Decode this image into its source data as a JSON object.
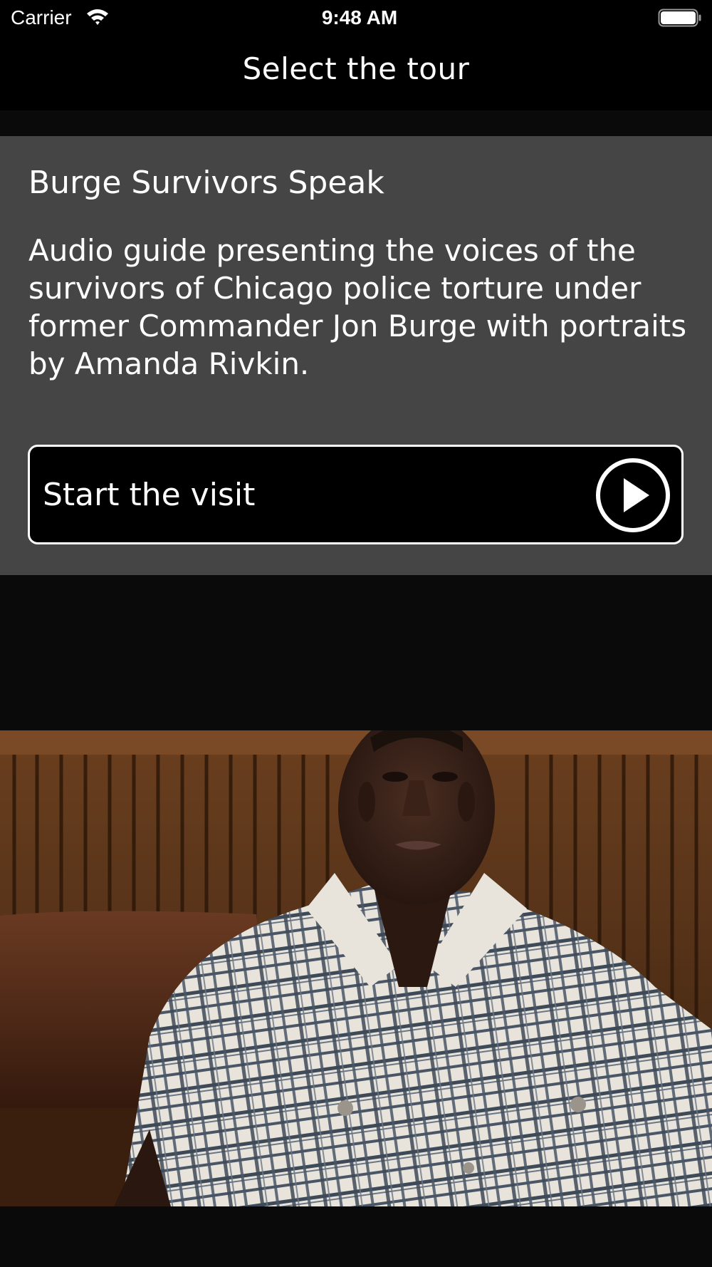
{
  "status_bar": {
    "carrier": "Carrier",
    "time": "9:48 AM",
    "icons": [
      "wifi-icon",
      "battery-icon"
    ]
  },
  "nav": {
    "title": "Select the tour"
  },
  "tour": {
    "title": "Burge Survivors Speak",
    "description": "Audio guide presenting the voices of the survivors of Chicago police torture under former Commander Jon Burge with portraits by Amanda Rivkin.",
    "start_label": "Start the visit",
    "start_icon": "play-icon"
  },
  "colors": {
    "background": "#0a0a0a",
    "bars": "#000000",
    "card": "#454545",
    "text": "#ffffff"
  }
}
